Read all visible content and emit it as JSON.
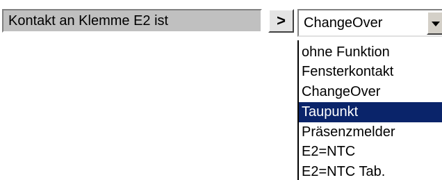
{
  "label": {
    "text": "Kontakt an Klemme E2 ist"
  },
  "arrow_button": {
    "label": ">"
  },
  "select": {
    "value": "ChangeOver"
  },
  "dropdown": {
    "options": [
      {
        "label": "ohne Funktion"
      },
      {
        "label": "Fensterkontakt"
      },
      {
        "label": "ChangeOver"
      },
      {
        "label": "Taupunkt",
        "highlighted": true
      },
      {
        "label": "Präsenzmelder"
      },
      {
        "label": "E2=NTC"
      },
      {
        "label": "E2=NTC Tab."
      }
    ]
  },
  "colors": {
    "highlight_bg": "#0a246a",
    "highlight_text": "#ffffff",
    "label_bg": "#c0c0c0"
  }
}
